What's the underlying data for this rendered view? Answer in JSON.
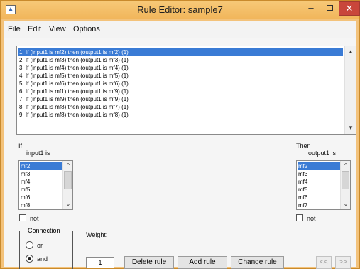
{
  "window": {
    "title": "Rule Editor: sample7",
    "minimize_glyph": "–",
    "close_glyph": "✕"
  },
  "menu": [
    "File",
    "Edit",
    "View",
    "Options"
  ],
  "rules": [
    "1. If (input1 is mf2) then (output1 is mf2) (1)",
    "2. If (input1 is mf3) then (output1 is mf3) (1)",
    "3. If (input1 is mf4) then (output1 is mf4) (1)",
    "4. If (input1 is mf5) then (output1 is mf5) (1)",
    "5. If (input1 is mf6) then (output1 is mf6) (1)",
    "6. If (input1 is mf1) then (output1 is mf9) (1)",
    "7. If (input1 is mf9) then (output1 is mf9) (1)",
    "8. If (input1 is mf8) then (output1 is mf7) (1)",
    "9. If (input1 is mf8) then (output1 is mf8) (1)"
  ],
  "selected_rule": 0,
  "if_panel": {
    "heading": "If",
    "var_label": "input1 is",
    "items": [
      "mf2",
      "mf3",
      "mf4",
      "mf5",
      "mf6",
      "mf8"
    ],
    "selected": 0,
    "not_label": "not"
  },
  "then_panel": {
    "heading": "Then",
    "var_label": "output1 is",
    "items": [
      "mf2",
      "mf3",
      "mf4",
      "mf5",
      "mf6",
      "mf7"
    ],
    "selected": 0,
    "not_label": "not"
  },
  "connection": {
    "title": "Connection",
    "options": [
      "or",
      "and"
    ],
    "selected": "and"
  },
  "weight": {
    "label": "Weight:",
    "value": "1"
  },
  "buttons": {
    "delete": "Delete rule",
    "add": "Add rule",
    "change": "Change rule",
    "prev": "<<",
    "next": ">>"
  },
  "icons": {
    "scroll_up": "chevron-up-icon",
    "scroll_down": "chevron-down-icon",
    "app": "matlab-icon"
  }
}
